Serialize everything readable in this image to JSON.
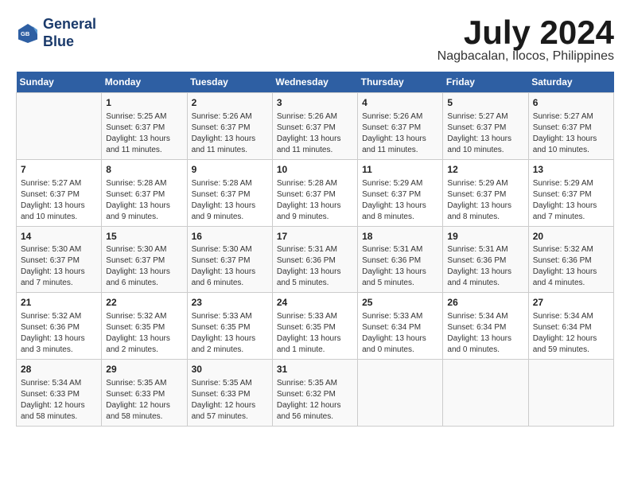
{
  "header": {
    "logo_line1": "General",
    "logo_line2": "Blue",
    "month_year": "July 2024",
    "location": "Nagbacalan, Ilocos, Philippines"
  },
  "weekdays": [
    "Sunday",
    "Monday",
    "Tuesday",
    "Wednesday",
    "Thursday",
    "Friday",
    "Saturday"
  ],
  "weeks": [
    [
      {
        "day": "",
        "info": ""
      },
      {
        "day": "1",
        "info": "Sunrise: 5:25 AM\nSunset: 6:37 PM\nDaylight: 13 hours\nand 11 minutes."
      },
      {
        "day": "2",
        "info": "Sunrise: 5:26 AM\nSunset: 6:37 PM\nDaylight: 13 hours\nand 11 minutes."
      },
      {
        "day": "3",
        "info": "Sunrise: 5:26 AM\nSunset: 6:37 PM\nDaylight: 13 hours\nand 11 minutes."
      },
      {
        "day": "4",
        "info": "Sunrise: 5:26 AM\nSunset: 6:37 PM\nDaylight: 13 hours\nand 11 minutes."
      },
      {
        "day": "5",
        "info": "Sunrise: 5:27 AM\nSunset: 6:37 PM\nDaylight: 13 hours\nand 10 minutes."
      },
      {
        "day": "6",
        "info": "Sunrise: 5:27 AM\nSunset: 6:37 PM\nDaylight: 13 hours\nand 10 minutes."
      }
    ],
    [
      {
        "day": "7",
        "info": "Sunrise: 5:27 AM\nSunset: 6:37 PM\nDaylight: 13 hours\nand 10 minutes."
      },
      {
        "day": "8",
        "info": "Sunrise: 5:28 AM\nSunset: 6:37 PM\nDaylight: 13 hours\nand 9 minutes."
      },
      {
        "day": "9",
        "info": "Sunrise: 5:28 AM\nSunset: 6:37 PM\nDaylight: 13 hours\nand 9 minutes."
      },
      {
        "day": "10",
        "info": "Sunrise: 5:28 AM\nSunset: 6:37 PM\nDaylight: 13 hours\nand 9 minutes."
      },
      {
        "day": "11",
        "info": "Sunrise: 5:29 AM\nSunset: 6:37 PM\nDaylight: 13 hours\nand 8 minutes."
      },
      {
        "day": "12",
        "info": "Sunrise: 5:29 AM\nSunset: 6:37 PM\nDaylight: 13 hours\nand 8 minutes."
      },
      {
        "day": "13",
        "info": "Sunrise: 5:29 AM\nSunset: 6:37 PM\nDaylight: 13 hours\nand 7 minutes."
      }
    ],
    [
      {
        "day": "14",
        "info": "Sunrise: 5:30 AM\nSunset: 6:37 PM\nDaylight: 13 hours\nand 7 minutes."
      },
      {
        "day": "15",
        "info": "Sunrise: 5:30 AM\nSunset: 6:37 PM\nDaylight: 13 hours\nand 6 minutes."
      },
      {
        "day": "16",
        "info": "Sunrise: 5:30 AM\nSunset: 6:37 PM\nDaylight: 13 hours\nand 6 minutes."
      },
      {
        "day": "17",
        "info": "Sunrise: 5:31 AM\nSunset: 6:36 PM\nDaylight: 13 hours\nand 5 minutes."
      },
      {
        "day": "18",
        "info": "Sunrise: 5:31 AM\nSunset: 6:36 PM\nDaylight: 13 hours\nand 5 minutes."
      },
      {
        "day": "19",
        "info": "Sunrise: 5:31 AM\nSunset: 6:36 PM\nDaylight: 13 hours\nand 4 minutes."
      },
      {
        "day": "20",
        "info": "Sunrise: 5:32 AM\nSunset: 6:36 PM\nDaylight: 13 hours\nand 4 minutes."
      }
    ],
    [
      {
        "day": "21",
        "info": "Sunrise: 5:32 AM\nSunset: 6:36 PM\nDaylight: 13 hours\nand 3 minutes."
      },
      {
        "day": "22",
        "info": "Sunrise: 5:32 AM\nSunset: 6:35 PM\nDaylight: 13 hours\nand 2 minutes."
      },
      {
        "day": "23",
        "info": "Sunrise: 5:33 AM\nSunset: 6:35 PM\nDaylight: 13 hours\nand 2 minutes."
      },
      {
        "day": "24",
        "info": "Sunrise: 5:33 AM\nSunset: 6:35 PM\nDaylight: 13 hours\nand 1 minute."
      },
      {
        "day": "25",
        "info": "Sunrise: 5:33 AM\nSunset: 6:34 PM\nDaylight: 13 hours\nand 0 minutes."
      },
      {
        "day": "26",
        "info": "Sunrise: 5:34 AM\nSunset: 6:34 PM\nDaylight: 13 hours\nand 0 minutes."
      },
      {
        "day": "27",
        "info": "Sunrise: 5:34 AM\nSunset: 6:34 PM\nDaylight: 12 hours\nand 59 minutes."
      }
    ],
    [
      {
        "day": "28",
        "info": "Sunrise: 5:34 AM\nSunset: 6:33 PM\nDaylight: 12 hours\nand 58 minutes."
      },
      {
        "day": "29",
        "info": "Sunrise: 5:35 AM\nSunset: 6:33 PM\nDaylight: 12 hours\nand 58 minutes."
      },
      {
        "day": "30",
        "info": "Sunrise: 5:35 AM\nSunset: 6:33 PM\nDaylight: 12 hours\nand 57 minutes."
      },
      {
        "day": "31",
        "info": "Sunrise: 5:35 AM\nSunset: 6:32 PM\nDaylight: 12 hours\nand 56 minutes."
      },
      {
        "day": "",
        "info": ""
      },
      {
        "day": "",
        "info": ""
      },
      {
        "day": "",
        "info": ""
      }
    ]
  ]
}
